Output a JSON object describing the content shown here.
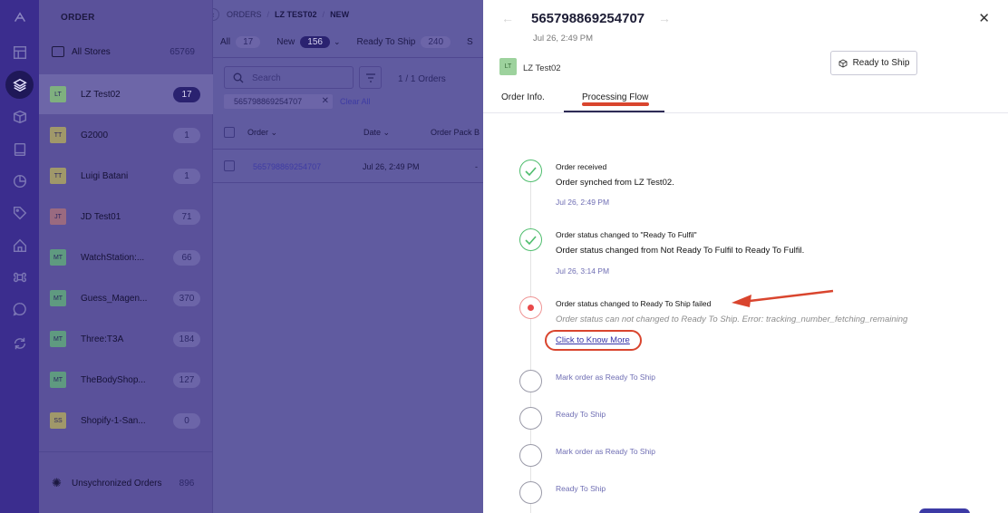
{
  "rail": {
    "icons": [
      "logo-icon",
      "dashboard-icon",
      "layers-icon",
      "box-icon",
      "book-icon",
      "chart-icon",
      "tag-icon",
      "home-icon",
      "command-icon",
      "chat-icon",
      "sync-icon"
    ]
  },
  "stores": {
    "title": "ORDER",
    "all": {
      "label": "All Stores",
      "count": "65769"
    },
    "items": [
      {
        "avatar": "LT",
        "name": "LZ Test02",
        "count": "17",
        "color": "#7fb07f",
        "selected": true
      },
      {
        "avatar": "TT",
        "name": "G2000",
        "count": "1",
        "color": "#a0986a"
      },
      {
        "avatar": "TT",
        "name": "Luigi Batani",
        "count": "1",
        "color": "#a0986a"
      },
      {
        "avatar": "JT",
        "name": "JD Test01",
        "count": "71",
        "color": "#9a6a80"
      },
      {
        "avatar": "MT",
        "name": "WatchStation:...",
        "count": "66",
        "color": "#5f9a80"
      },
      {
        "avatar": "MT",
        "name": "Guess_Magen...",
        "count": "370",
        "color": "#5f9a80"
      },
      {
        "avatar": "MT",
        "name": "Three:T3A",
        "count": "184",
        "color": "#5f9a80"
      },
      {
        "avatar": "MT",
        "name": "TheBodyShop...",
        "count": "127",
        "color": "#5f9a80"
      },
      {
        "avatar": "SS",
        "name": "Shopify-1-San...",
        "count": "0",
        "color": "#a0986a"
      }
    ],
    "unsync": {
      "label": "Unsychronized Orders",
      "count": "896"
    }
  },
  "main": {
    "breadcrumb": [
      "ORDERS",
      "LZ TEST02",
      "NEW"
    ],
    "tabs": [
      {
        "label": "All",
        "count": "17"
      },
      {
        "label": "New",
        "count": "156"
      },
      {
        "label": "Ready To Ship",
        "count": "240"
      },
      {
        "label": "S",
        "count": ""
      }
    ],
    "search_placeholder": "Search",
    "pager": "1 / 1 Orders",
    "filter_chip": "565798869254707",
    "clear_all": "Clear All",
    "columns": [
      "Order",
      "Date",
      "Order Pack B"
    ],
    "row": {
      "order": "565798869254707",
      "date": "Jul 26, 2:49 PM",
      "extra": "-"
    }
  },
  "drawer": {
    "order_no": "565798869254707",
    "date": "Jul 26, 2:49 PM",
    "store_avatar": "LT",
    "store_name": "LZ Test02",
    "ready_button": "Ready to Ship",
    "tabs": [
      "Order Info.",
      "Processing Flow"
    ],
    "events": [
      {
        "title": "Order received",
        "desc": "Order synched from LZ Test02.",
        "date": "Jul 26, 2:49 PM",
        "status": "done"
      },
      {
        "title": "Order status changed to \"Ready To Fulfil\"",
        "desc": "Order status changed from Not Ready To Fulfil to Ready To Fulfil.",
        "date": "Jul 26, 3:14 PM",
        "status": "done"
      },
      {
        "title": "Order status changed to Ready To Ship failed",
        "error": "Order status can not changed to Ready To Ship. Error: tracking_number_fetching_remaining",
        "link": "Click to Know More",
        "status": "failed"
      }
    ],
    "pending": [
      "Mark order as Ready To Ship",
      "Ready To Ship",
      "Mark order as Ready To Ship",
      "Ready To Ship"
    ]
  },
  "colors": {
    "accent": "#3734a8",
    "success": "#4ebd6d",
    "error": "#e9494a",
    "annotation": "#d9452e"
  }
}
